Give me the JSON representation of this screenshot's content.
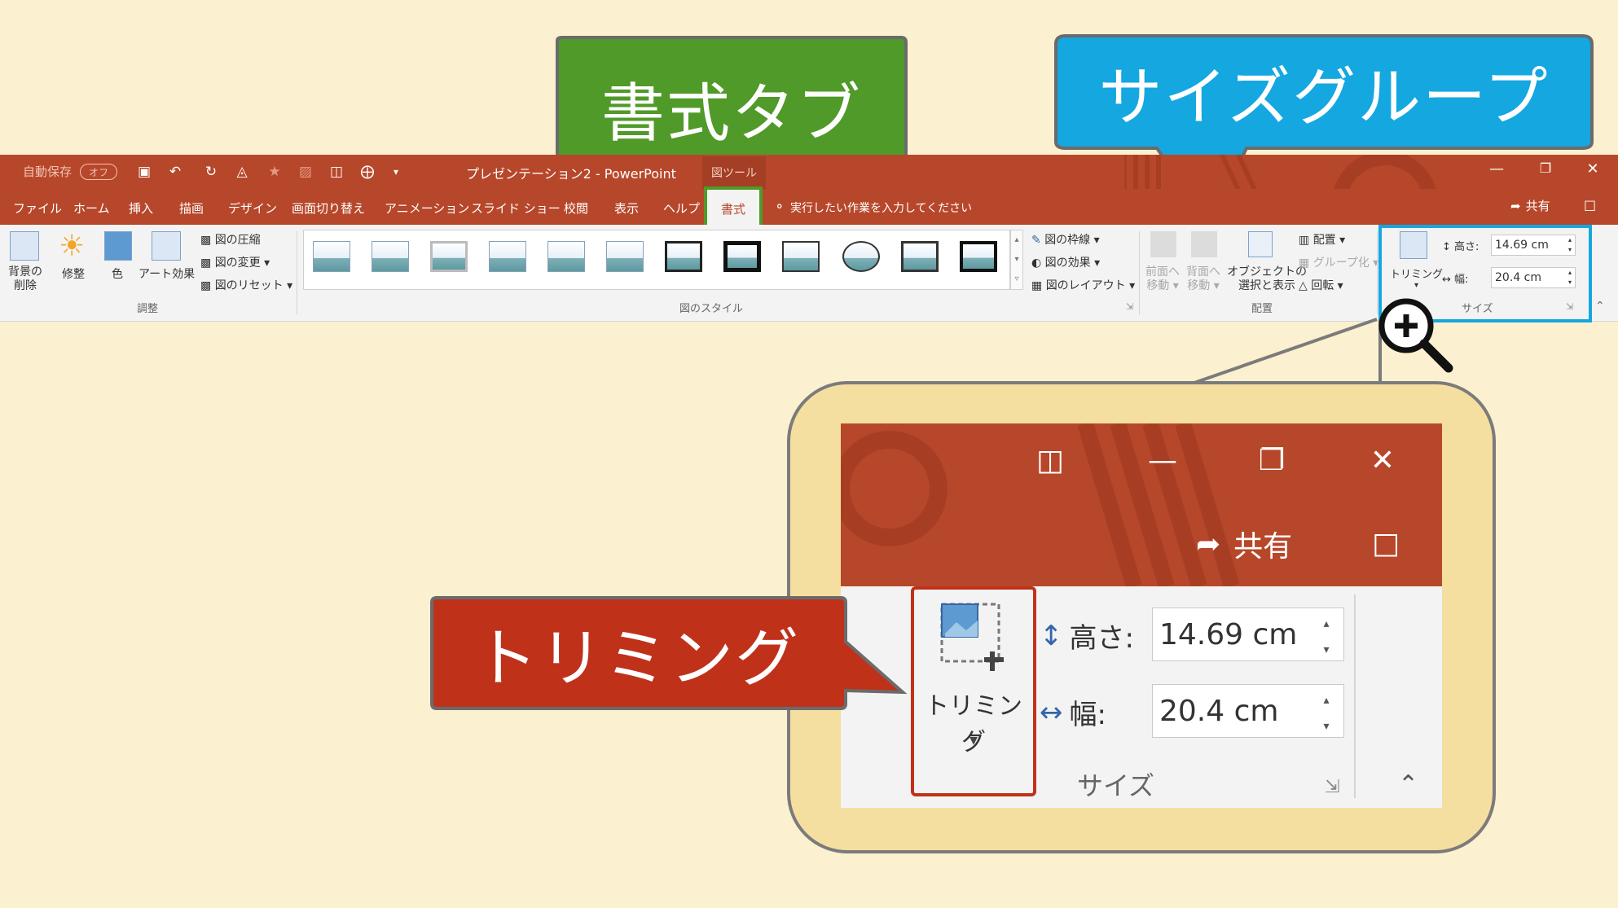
{
  "callouts": {
    "format_tab": "書式タブ",
    "size_group": "サイズグループ",
    "trimming": "トリミング"
  },
  "titlebar": {
    "autosave_label": "自動保存",
    "autosave_state": "オフ",
    "doc_title": "プレゼンテーション2 - PowerPoint",
    "context_tool": "図ツール",
    "qat_icons": [
      "save-icon",
      "undo-icon",
      "redo-icon",
      "present-icon",
      "star-icon",
      "picture-icon",
      "presenter-icon",
      "crop-icon",
      "customize-icon"
    ]
  },
  "tabs": [
    "ファイル",
    "ホーム",
    "挿入",
    "描画",
    "デザイン",
    "画面切り替え",
    "アニメーション",
    "スライド ショー",
    "校閲",
    "表示",
    "ヘルプ",
    "書式"
  ],
  "tell_me": "実行したい作業を入力してください",
  "share": "共有",
  "ribbon": {
    "adjust": {
      "remove_bg": [
        "背景の",
        "削除"
      ],
      "corrections": "修整",
      "color": "色",
      "artistic": "アート効果",
      "compress": "図の圧縮",
      "change": "図の変更",
      "reset": "図のリセット",
      "group_label": "調整"
    },
    "styles": {
      "group_label": "図のスタイル",
      "border": "図の枠線",
      "effects": "図の効果",
      "layout": "図のレイアウト"
    },
    "arrange": {
      "bring_forward": [
        "前面へ",
        "移動"
      ],
      "send_backward": [
        "背面へ",
        "移動"
      ],
      "selection_pane": [
        "オブジェクトの",
        "選択と表示"
      ],
      "align": "配置",
      "group": "グループ化",
      "rotate": "回転",
      "group_label": "配置"
    },
    "size": {
      "crop": "トリミング",
      "height_label": "高さ:",
      "height_value": "14.69 cm",
      "width_label": "幅:",
      "width_value": "20.4 cm",
      "group_label": "サイズ"
    }
  },
  "colors": {
    "accent": "#b7472a",
    "ribbon": "#f3f3f3",
    "background": "#fbf0d0",
    "callout_green": "#4f9a28",
    "callout_blue": "#14a7e0",
    "callout_red": "#c0311a",
    "zoom_fill": "#f5dfa0"
  }
}
